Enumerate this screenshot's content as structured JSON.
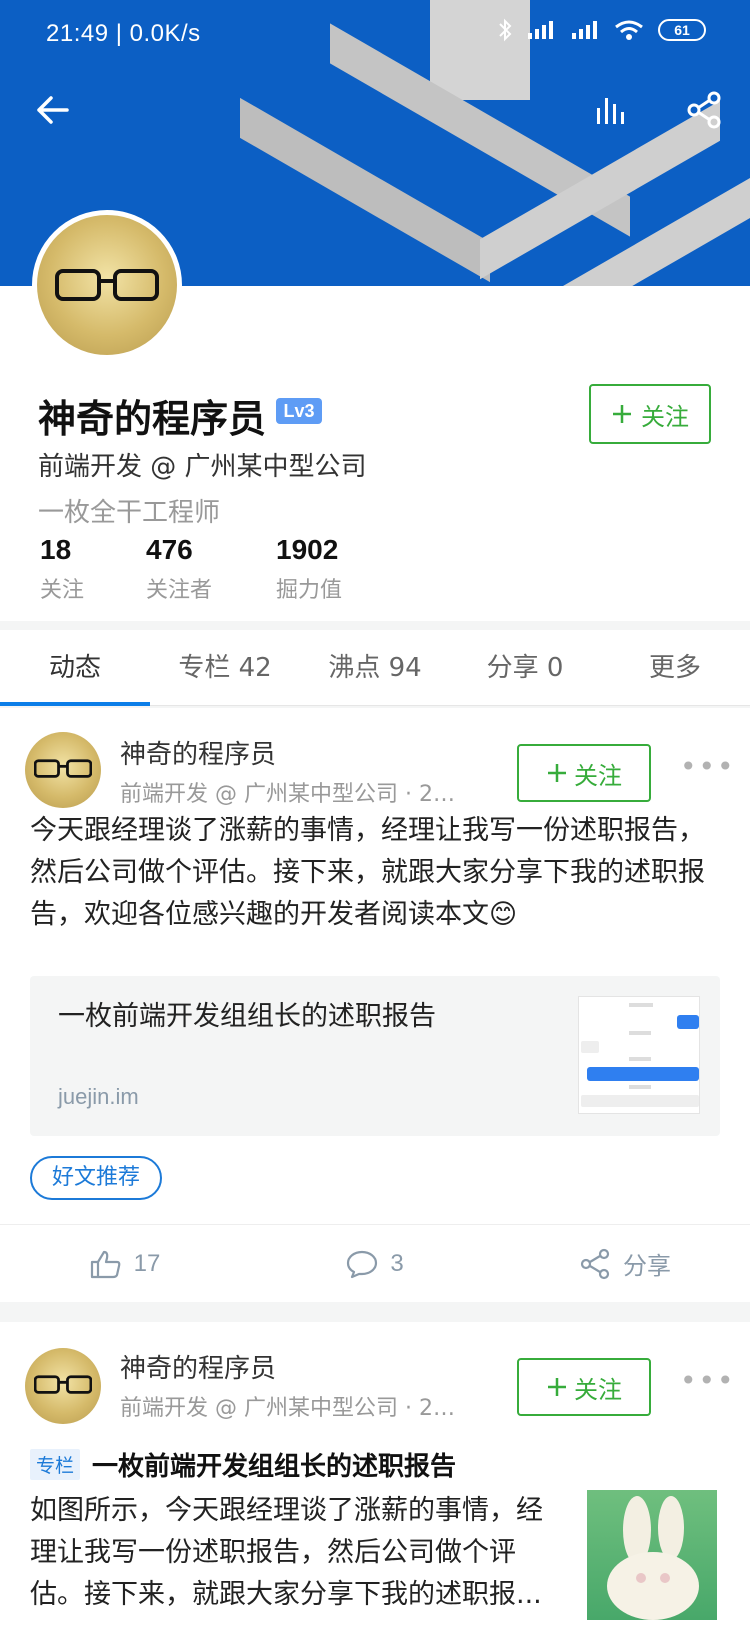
{
  "status_bar": {
    "time": "21:49 | 0.0K/s",
    "battery": "61"
  },
  "profile": {
    "name": "神奇的程序员",
    "level": "Lv3",
    "job": "前端开发 @ 广州某中型公司",
    "motto": "一枚全干工程师",
    "follow_label": "关注",
    "stats": [
      {
        "num": "18",
        "label": "关注"
      },
      {
        "num": "476",
        "label": "关注者"
      },
      {
        "num": "1902",
        "label": "掘力值"
      }
    ]
  },
  "tabs": [
    {
      "label": "动态"
    },
    {
      "label": "专栏 42"
    },
    {
      "label": "沸点 94"
    },
    {
      "label": "分享 0"
    },
    {
      "label": "更多"
    }
  ],
  "posts": [
    {
      "author": "神奇的程序员",
      "meta": "前端开发 @ 广州某中型公司 · 20...",
      "follow_label": "关注",
      "text": "今天跟经理谈了涨薪的事情，经理让我写一份述职报告，然后公司做个评估。接下来，就跟大家分享下我的述职报告，欢迎各位感兴趣的开发者阅读本文😊",
      "link_title": "一枚前端开发组组长的述职报告",
      "link_url": "juejin.im",
      "topic": "好文推荐",
      "likes": "17",
      "comments": "3",
      "share_label": "分享"
    },
    {
      "author": "神奇的程序员",
      "meta": "前端开发 @ 广州某中型公司 · 20...",
      "follow_label": "关注",
      "tag": "专栏",
      "title": "一枚前端开发组组长的述职报告",
      "excerpt": "如图所示，今天跟经理谈了涨薪的事情，经理让我写一份述职报告，然后公司做个评估。接下来，就跟大家分享下我的述职报..."
    }
  ],
  "icons": {
    "back": "back-arrow-icon",
    "stats": "bar-chart-icon",
    "share": "share-icon",
    "like": "thumbs-up-icon",
    "comment": "comment-icon",
    "more": "more-dots-icon"
  },
  "colors": {
    "banner": "#0c5fc4",
    "follow_green": "#37ac3b",
    "accent_blue": "#0c7ee8",
    "level_badge": "#5e9cf5"
  }
}
